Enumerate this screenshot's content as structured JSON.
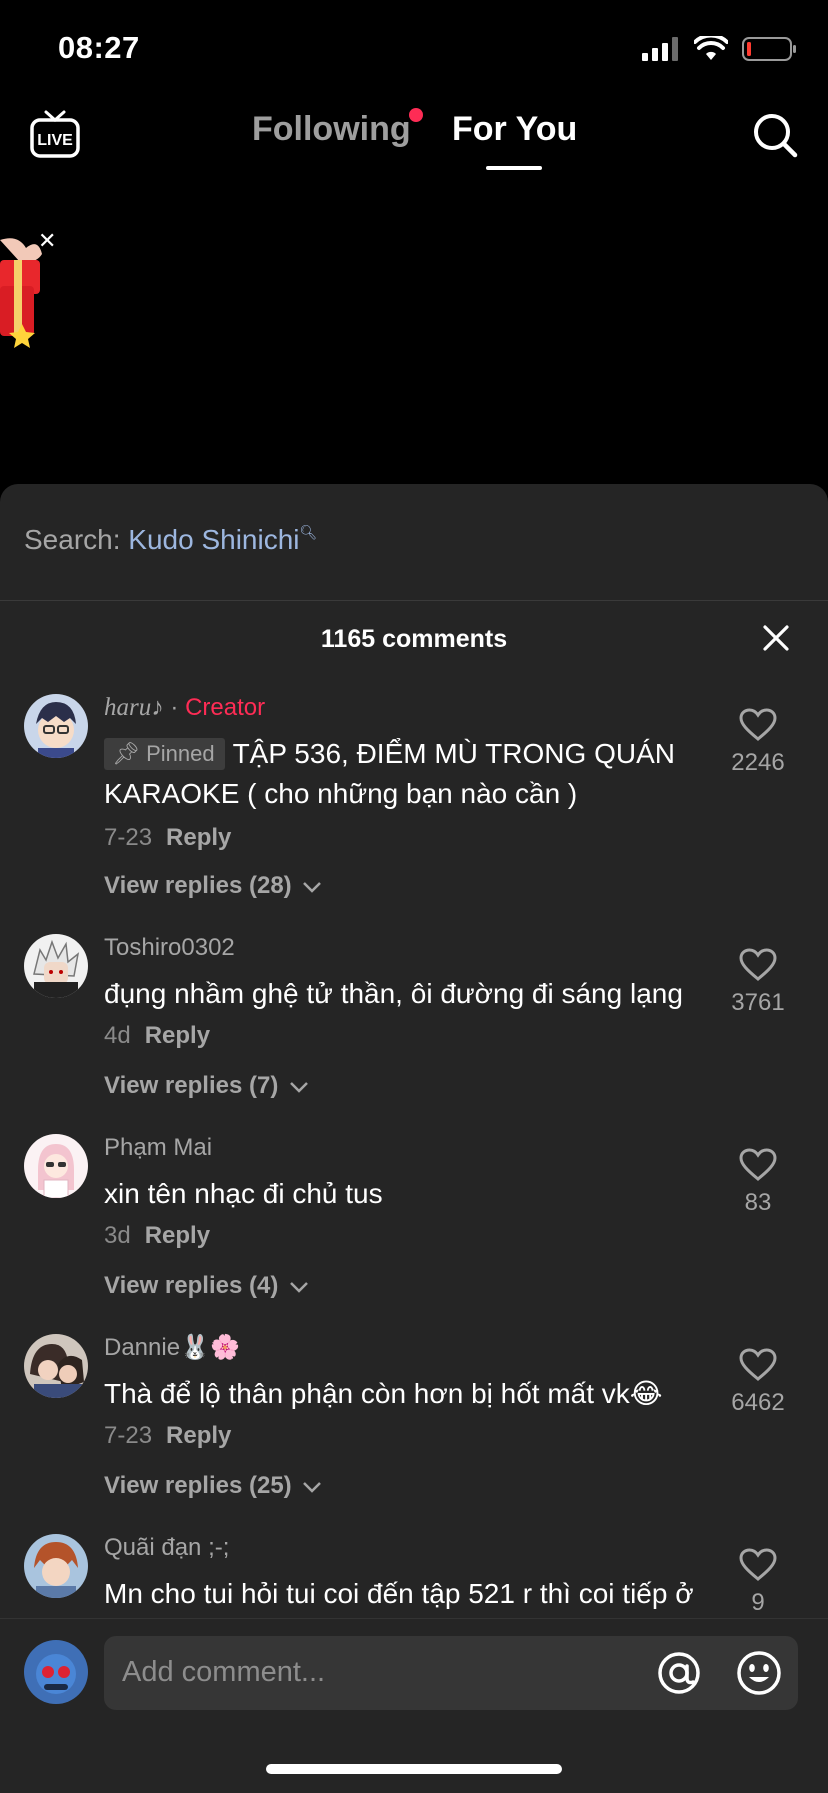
{
  "status_bar": {
    "time": "08:27"
  },
  "nav": {
    "following_label": "Following",
    "for_you_label": "For You",
    "live_label": "LIVE"
  },
  "sheet": {
    "search_prefix": "Search:",
    "search_term": "Kudo Shinichi",
    "comments_count": "1165 comments"
  },
  "comments": [
    {
      "username": "haru♪",
      "separator": "·",
      "badge": "Creator",
      "pinned_label": "Pinned",
      "text": "TẬP 536, ĐIỂM MÙ TRONG QUÁN KARAOKE ( cho những bạn nào cần )",
      "date": "7-23",
      "reply_label": "Reply",
      "view_replies": "View replies (28)",
      "likes": "2246"
    },
    {
      "username": "Toshiro0302",
      "text": "đụng nhầm ghệ tử thần, ôi đường đi sáng lạng",
      "date": "4d",
      "reply_label": "Reply",
      "view_replies": "View replies (7)",
      "likes": "3761"
    },
    {
      "username": "Phạm Mai",
      "text": "xin tên nhạc đi chủ tus",
      "date": "3d",
      "reply_label": "Reply",
      "view_replies": "View replies (4)",
      "likes": "83"
    },
    {
      "username": "Dannie🐰🌸",
      "text": "Thà để lộ thân phận còn hơn bị hốt mất vk😂",
      "date": "7-23",
      "reply_label": "Reply",
      "view_replies": "View replies (25)",
      "likes": "6462"
    },
    {
      "username": "Quãi đạn ;-;",
      "text": "Mn cho tui hỏi tui coi đến tập 521 r thì coi tiếp ở",
      "likes": "9"
    }
  ],
  "composer": {
    "placeholder": "Add comment..."
  },
  "colors": {
    "accent": "#fe2c55",
    "sheet_bg": "#252525",
    "search_term": "#9db7e0"
  }
}
